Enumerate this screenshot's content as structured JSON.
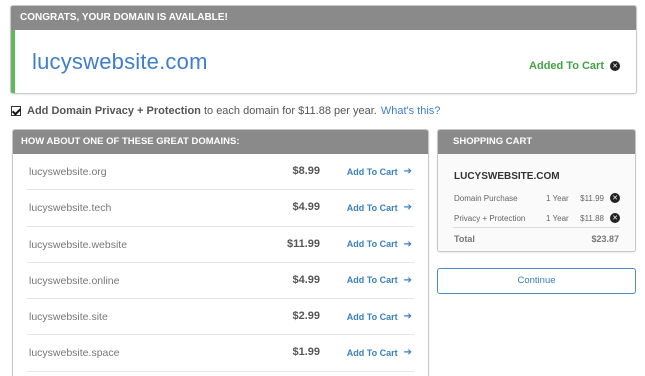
{
  "congrats": {
    "header": "CONGRATS, YOUR DOMAIN IS AVAILABLE!",
    "domain": "lucyswebsite.com",
    "status": "Added To Cart",
    "accent_color": "#5fb85d"
  },
  "privacy": {
    "checked": true,
    "label_bold": "Add Domain Privacy + Protection",
    "label_rest": " to each domain for $11.88 per year.",
    "link": "What's this?"
  },
  "suggestions": {
    "header": "HOW ABOUT ONE OF THESE GREAT DOMAINS:",
    "add_label": "Add To Cart",
    "items": [
      {
        "name": "lucyswebsite.org",
        "price": "$8.99"
      },
      {
        "name": "lucyswebsite.tech",
        "price": "$4.99"
      },
      {
        "name": "lucyswebsite.website",
        "price": "$11.99"
      },
      {
        "name": "lucyswebsite.online",
        "price": "$4.99"
      },
      {
        "name": "lucyswebsite.site",
        "price": "$2.99"
      },
      {
        "name": "lucyswebsite.space",
        "price": "$1.99"
      }
    ]
  },
  "cart": {
    "header": "SHOPPING CART",
    "domain": "LUCYSWEBSITE.COM",
    "items": [
      {
        "label": "Domain Purchase",
        "term": "1 Year",
        "amount": "$11.99"
      },
      {
        "label": "Privacy + Protection",
        "term": "1 Year",
        "amount": "$11.88"
      }
    ],
    "total_label": "Total",
    "total": "$23.87"
  },
  "continue_label": "Continue",
  "colors": {
    "header_gray": "#8a8a8a",
    "link_blue": "#3a7fbf",
    "success_green": "#44a244"
  }
}
